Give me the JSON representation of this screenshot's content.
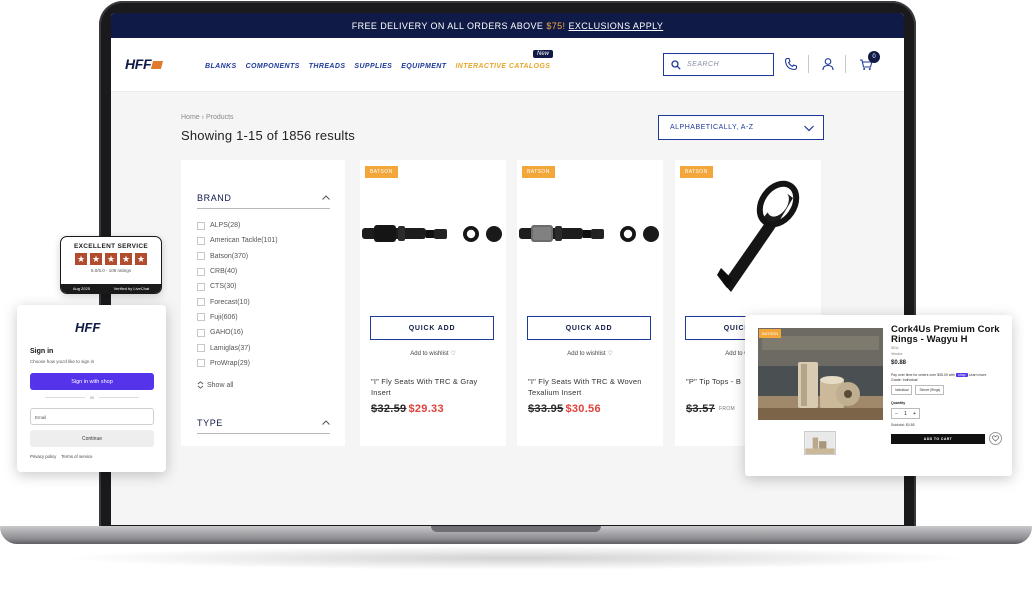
{
  "announcement": {
    "before": "FREE DELIVERY ON ALL ORDERS ABOVE",
    "price": "$75!",
    "link": "EXCLUSIONS APPLY"
  },
  "header": {
    "logo": "HFF",
    "nav": [
      "BLANKS",
      "COMPONENTS",
      "THREADS",
      "SUPPLIES",
      "EQUIPMENT",
      "INTERACTIVE CATALOGS"
    ],
    "new_badge": "New",
    "search_placeholder": "SEARCH",
    "cart_count": "0"
  },
  "listing": {
    "breadcrumb_home": "Home",
    "breadcrumb_sep": "›",
    "breadcrumb_current": "Products",
    "results_text": "Showing 1-15 of 1856 results",
    "sort_value": "ALPHABETICALLY, A-Z"
  },
  "filters": {
    "brand_title": "BRAND",
    "type_title": "TYPE",
    "show_all": "Show all",
    "brands": [
      "ALPS(28)",
      "American Tackle(101)",
      "Batson(370)",
      "CRB(40)",
      "CTS(30)",
      "Forecast(10)",
      "Fuji(606)",
      "GAHO(16)",
      "Lamiglas(37)",
      "ProWrap(29)"
    ]
  },
  "products": [
    {
      "badge": "BATSON",
      "quick_add": "QUICK ADD",
      "wishlist": "Add to wishlist",
      "name": "\"I\" Fly Seats With TRC & Gray Insert",
      "old_price": "$32.59",
      "new_price": "$29.33",
      "from": ""
    },
    {
      "badge": "BATSON",
      "quick_add": "QUICK ADD",
      "wishlist": "Add to wishlist",
      "name": "\"I\" Fly Seats With TRC & Woven Texalium Insert",
      "old_price": "$33.95",
      "new_price": "$30.56",
      "from": ""
    },
    {
      "badge": "BATSON",
      "quick_add": "QUICK ADD",
      "wishlist": "Add to wishlist",
      "name": "\"P\" Tip Tops - B",
      "old_price": "$3.57",
      "new_price": "",
      "from": "FROM"
    }
  ],
  "review_widget": {
    "title": "EXCELLENT SERVICE",
    "score": "5.0/5.0 - 109 ratings",
    "date": "Aug 2025",
    "verified": "Verified by LiveChat"
  },
  "signin": {
    "logo": "HFF",
    "title": "Sign in",
    "subtitle": "Choose how you'd like to sign in",
    "shop_button": "Sign in with shop",
    "or": "or",
    "email_placeholder": "Email",
    "continue": "Continue",
    "privacy": "Privacy policy",
    "terms": "Terms of service"
  },
  "product_popup": {
    "tag": "BATSON",
    "title": "Cork4Us Premium Cork Rings - Wagyu H",
    "sku": "SKU:",
    "vendor": "Vendor:",
    "price": "$0.88",
    "pay_text": "Pay over time for orders over $35.00 with",
    "shop_pay": "shop",
    "learn_more": "Learn more",
    "subtitle": "Grade: Individual",
    "options": [
      "Individual",
      "Sleeve (Rings)"
    ],
    "qty_label": "Quantity",
    "qty_minus": "−",
    "qty_value": "1",
    "qty_plus": "+",
    "subtotal": "Subtotal: $0.88",
    "add_to_cart": "ADD TO CART"
  },
  "colors": {
    "navy": "#0f1a47",
    "nav_blue": "#1d3a9a",
    "accent_orange": "#f3a73b",
    "sale_red": "#e0413a",
    "shop_purple": "#5433eb"
  }
}
